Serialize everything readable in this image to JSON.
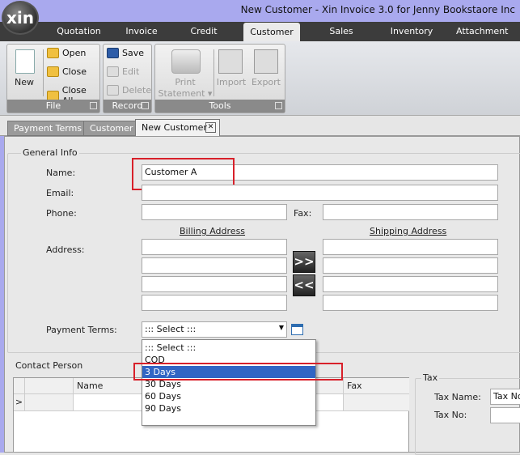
{
  "window": {
    "title": "New Customer - Xin Invoice 3.0 for Jenny Bookstaore Inc",
    "logo": "xin"
  },
  "menu_tabs": [
    {
      "label": "Quotation"
    },
    {
      "label": "Invoice"
    },
    {
      "label": "Credit Note"
    },
    {
      "label": "Customer",
      "active": true
    },
    {
      "label": "Sales Person"
    },
    {
      "label": "Inventory"
    },
    {
      "label": "Attachment"
    }
  ],
  "ribbon": {
    "file": {
      "caption": "File",
      "new": "New",
      "open": "Open",
      "close": "Close",
      "close_all": "Close All"
    },
    "record": {
      "caption": "Record",
      "save": "Save",
      "edit": "Edit",
      "delete": "Delete"
    },
    "tools": {
      "caption": "Tools",
      "print_statement": "Print",
      "print_statement2": "Statement ▾",
      "import": "Import",
      "export": "Export"
    }
  },
  "doc_tabs": [
    {
      "label": "Payment Terms"
    },
    {
      "label": "Customer"
    },
    {
      "label": "New Customer",
      "active": true
    }
  ],
  "close_tab_glyph": "✕",
  "general_info": {
    "title": "General Info",
    "name_label": "Name:",
    "name_value": "Customer A",
    "email_label": "Email:",
    "email_value": "",
    "phone_label": "Phone:",
    "phone_value": "",
    "fax_label": "Fax:",
    "fax_value": "",
    "address_label": "Address:",
    "billing_header": "Billing Address",
    "shipping_header": "Shipping Address",
    "copy_to_shipping": ">>",
    "copy_to_billing": "<<",
    "payment_terms_label": "Payment Terms:",
    "payment_terms_value": "::: Select :::"
  },
  "payment_terms_options": [
    "::: Select :::",
    "COD",
    "3 Days",
    "30 Days",
    "60 Days",
    "90 Days"
  ],
  "payment_terms_highlighted": "3 Days",
  "contact_person": {
    "title": "Contact Person",
    "columns": [
      "",
      "Name",
      "e",
      "Fax"
    ],
    "row_indicator": ">"
  },
  "tax": {
    "title": "Tax",
    "name_label": "Tax Name:",
    "name_value": "Tax No",
    "no_label": "Tax No:",
    "no_value": ""
  },
  "colors": {
    "titlebar": "#a9a9ee",
    "tabbar": "#3c3c3c",
    "highlight": "#3165c4",
    "annotation": "#d8202a"
  }
}
